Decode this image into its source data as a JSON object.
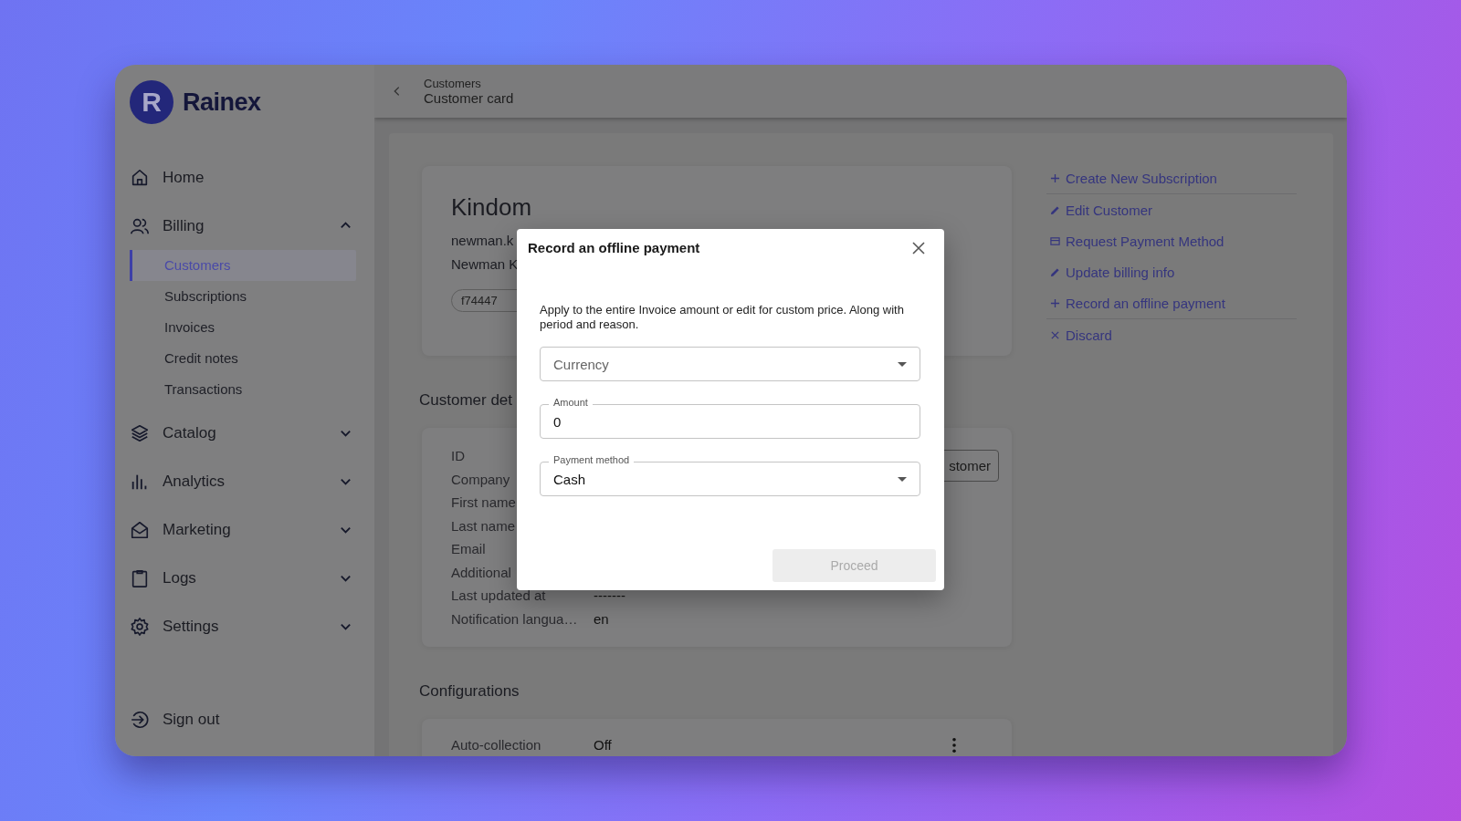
{
  "logo": {
    "text": "Rainex",
    "mark": "R"
  },
  "home_link": {
    "label": "Home"
  },
  "nav_groups": [
    {
      "label": "Billing",
      "expanded": true,
      "children": [
        {
          "label": "Customers",
          "selected": true
        },
        {
          "label": "Subscriptions",
          "selected": false
        },
        {
          "label": "Invoices",
          "selected": false
        },
        {
          "label": "Credit notes",
          "selected": false
        },
        {
          "label": "Transactions",
          "selected": false
        }
      ]
    },
    {
      "label": "Catalog",
      "expanded": false
    },
    {
      "label": "Analytics",
      "expanded": false
    },
    {
      "label": "Marketing",
      "expanded": false
    },
    {
      "label": "Logs",
      "expanded": false
    },
    {
      "label": "Settings",
      "expanded": false
    }
  ],
  "sign_out": {
    "label": "Sign out"
  },
  "header": {
    "breadcrumb_parent": "Customers",
    "title": "Customer card"
  },
  "customer": {
    "name": "Kindom",
    "email": "newman.k",
    "contact": "Newman K",
    "id_chip": "f74447"
  },
  "actions": [
    {
      "label": "Create New Subscription",
      "kind": "plus",
      "divider_after": true
    },
    {
      "label": "Edit Customer",
      "kind": "edit",
      "divider_after": false
    },
    {
      "label": "Request Payment Method",
      "kind": "card",
      "divider_after": false
    },
    {
      "label": "Update billing info",
      "kind": "edit",
      "divider_after": false
    },
    {
      "label": "Record an offline payment",
      "kind": "plus",
      "divider_after": true
    },
    {
      "label": "Discard",
      "kind": "close",
      "divider_after": false
    }
  ],
  "details": {
    "title": "Customer det",
    "button": "stomer",
    "rows": [
      {
        "label": "ID"
      },
      {
        "label": "Company"
      },
      {
        "label": "First name"
      },
      {
        "label": "Last name"
      },
      {
        "label": "Email"
      },
      {
        "label": "Additional"
      },
      {
        "label": "Last updated at",
        "value": "-------"
      },
      {
        "label": "Notification langua…",
        "value": "en"
      }
    ]
  },
  "configurations": {
    "title": "Configurations",
    "rows": [
      {
        "label": "Auto-collection",
        "value": "Off"
      }
    ]
  },
  "dialog": {
    "title": "Record an offline payment",
    "description": "Apply to the entire Invoice amount or edit for custom price. Along with period and reason.",
    "fields": [
      {
        "kind": "select",
        "placeholder": "Currency"
      },
      {
        "kind": "input",
        "label": "Amount",
        "value": "0"
      },
      {
        "kind": "select",
        "label": "Payment method",
        "value": "Cash"
      }
    ],
    "proceed": {
      "label": "Proceed",
      "disabled": true
    }
  }
}
